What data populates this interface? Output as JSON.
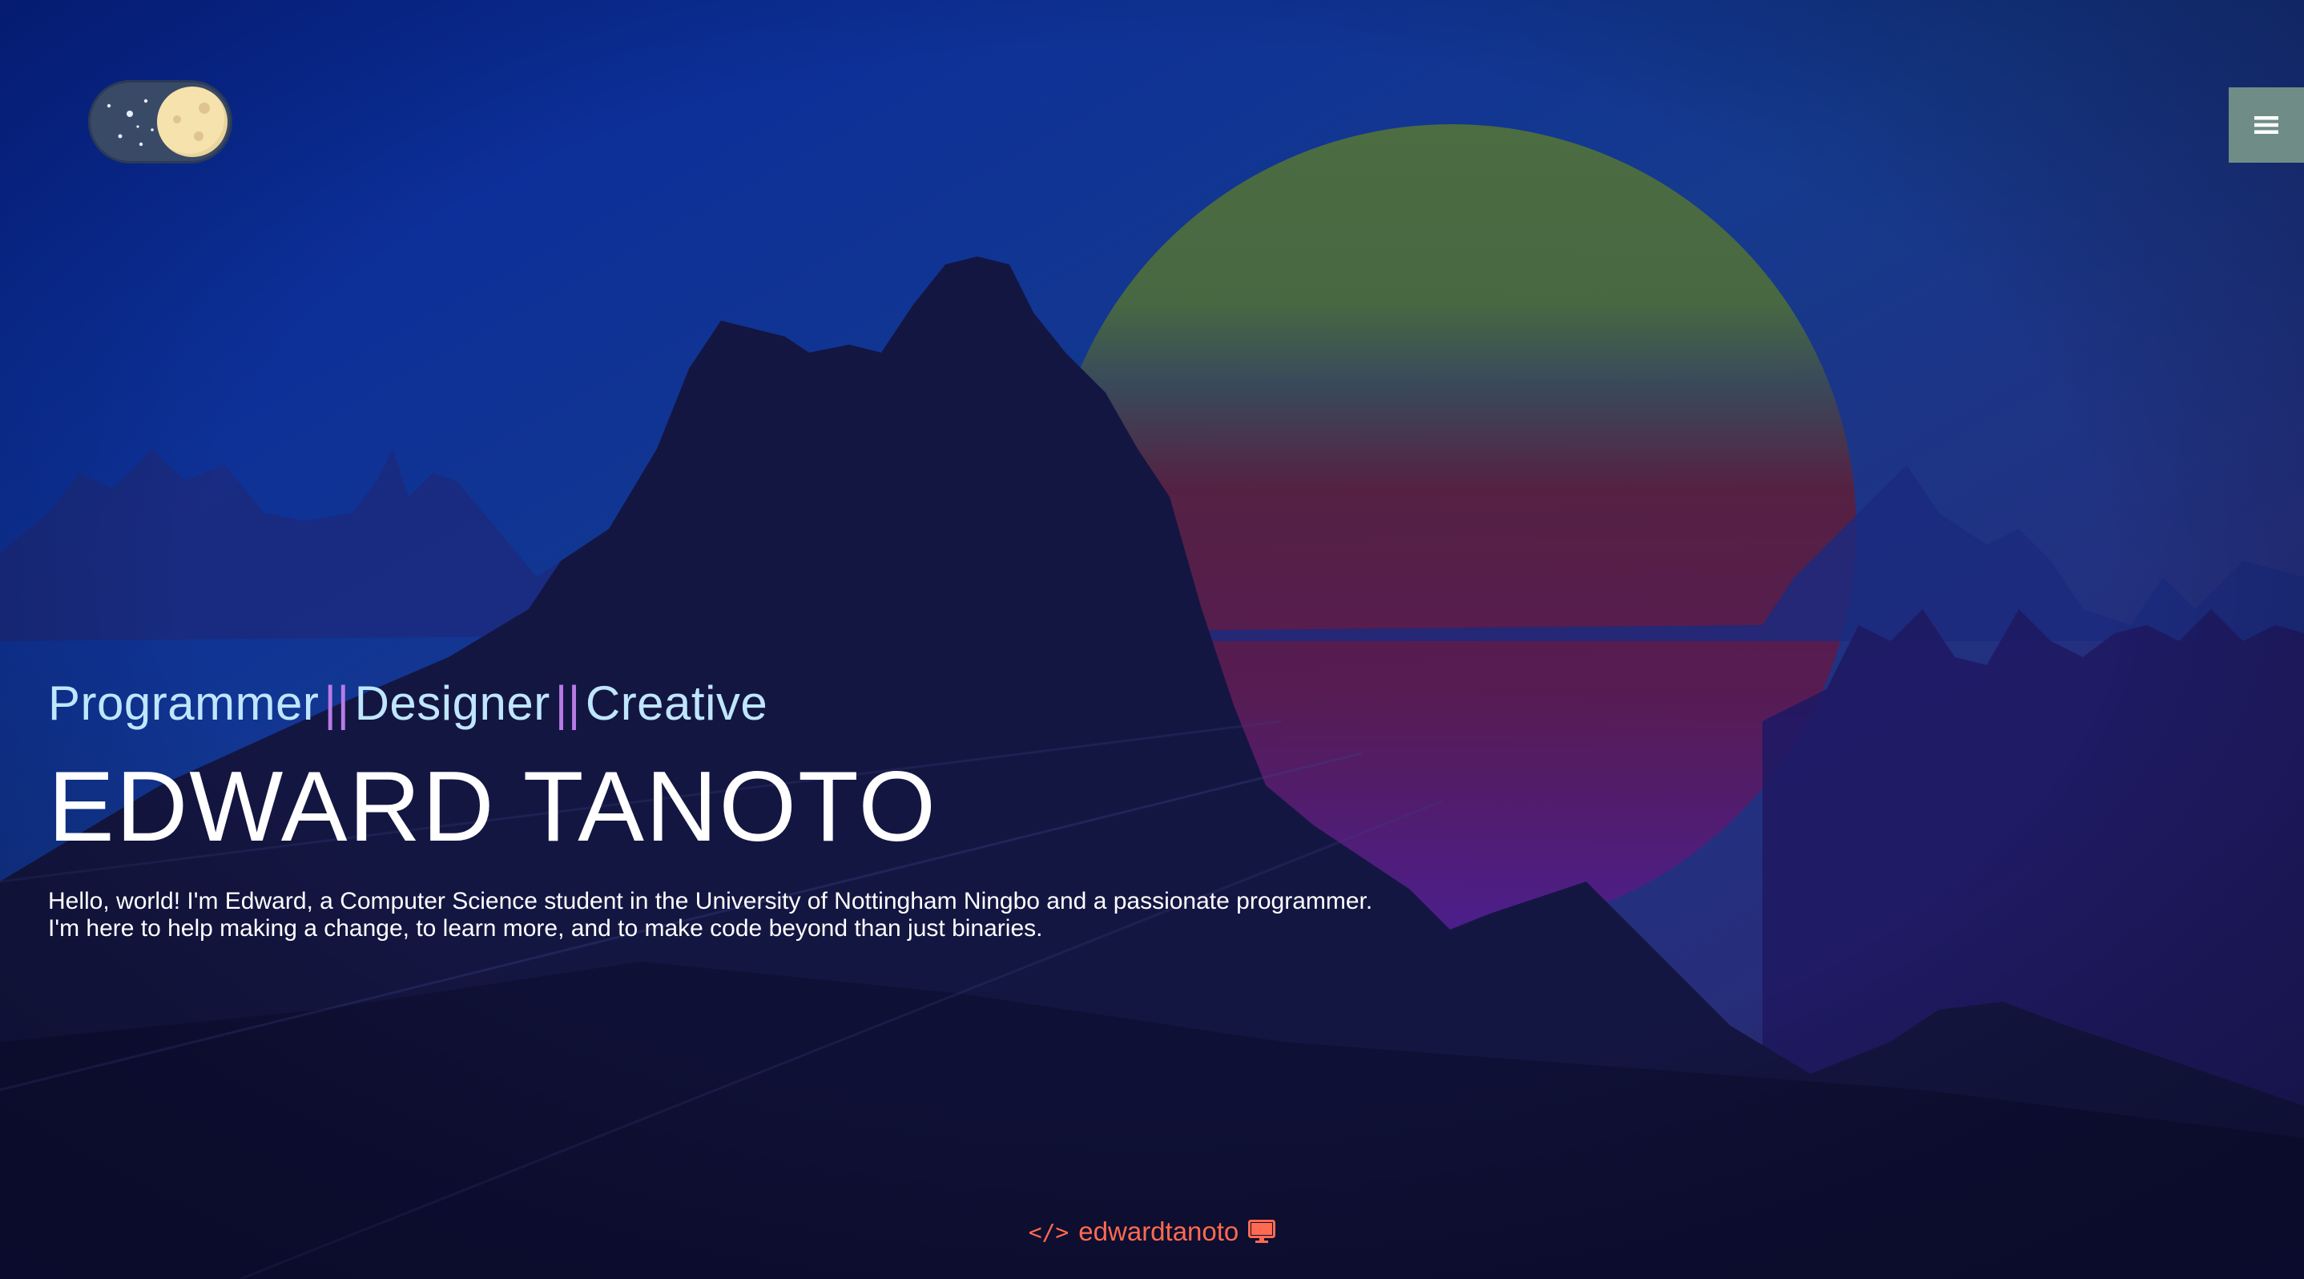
{
  "theme_toggle": {
    "icon": "moon-icon",
    "state": "dark"
  },
  "menu": {
    "icon": "hamburger-menu-icon",
    "background": "#6f8d86"
  },
  "hero": {
    "roles": [
      "Programmer",
      "Designer",
      "Creative"
    ],
    "separator": "||",
    "name": "EDWARD TANOTO",
    "bio_line_1": "Hello, world! I'm Edward, a Computer Science student in the University of Nottingham Ningbo and a passionate programmer.",
    "bio_line_2": "I'm here to help making a change, to learn more, and to make code beyond than just binaries."
  },
  "footer": {
    "code_icon": "</>",
    "handle": "edwardtanoto",
    "monitor_icon": "desktop-icon",
    "color": "#ff6a50"
  },
  "colors": {
    "role_text": "#bfe6ff",
    "separator": "#b77be6",
    "sky_top": "#0a2a9a",
    "sky_bottom": "#0e0f33"
  }
}
